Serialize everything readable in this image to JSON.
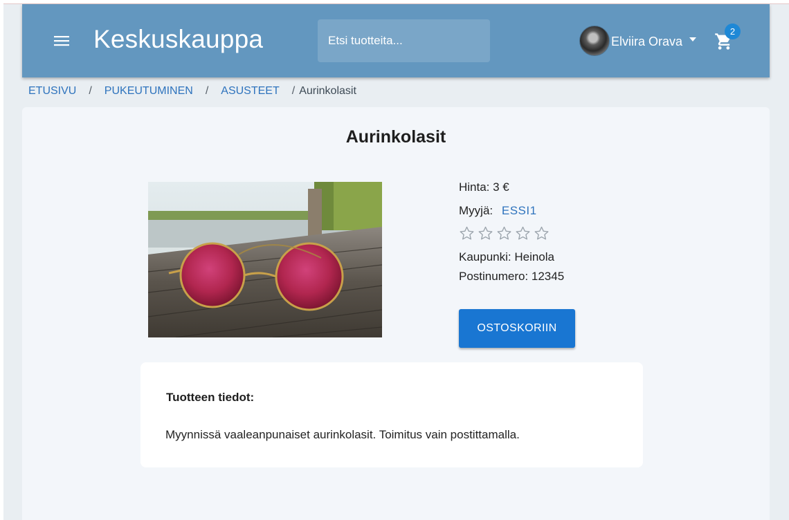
{
  "header": {
    "brand": "Keskuskauppa",
    "search_placeholder": "Etsi tuotteita...",
    "user_name": "Elviira Orava",
    "cart_count": "2",
    "color": "#6397bf"
  },
  "breadcrumb": {
    "items": [
      "ETUSIVU",
      "PUKEUTUMINEN",
      "ASUSTEET"
    ],
    "separator": "/",
    "current": "Aurinkolasit"
  },
  "product": {
    "title": "Aurinkolasit",
    "price_label": "Hinta: 3 €",
    "seller_label": "Myyjä:",
    "seller_name": "ESSI1",
    "rating": 0,
    "rating_max": 5,
    "city_label": "Kaupunki: Heinola",
    "postal_label": "Postinumero: 12345",
    "add_to_cart_label": "OSTOSKORIIN",
    "image_icon": "sunglasses-photo"
  },
  "details": {
    "heading": "Tuotteen tiedot:",
    "description": "Myynnissä vaaleanpunaiset aurinkolasit. Toimitus vain postittamalla."
  },
  "colors": {
    "accent": "#1976d2",
    "link": "#2e73bd",
    "badge": "#1e88d6"
  }
}
